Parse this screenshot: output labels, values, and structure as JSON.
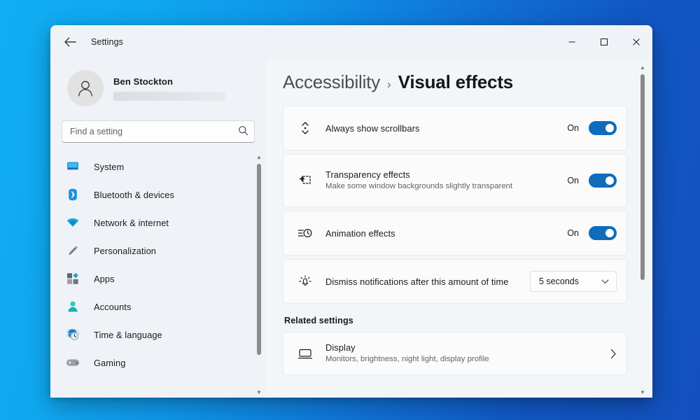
{
  "window": {
    "titlebar_title": "Settings",
    "back_icon": "arrow-left-icon",
    "controls": {
      "minimize": "minimize-icon",
      "maximize": "maximize-icon",
      "close": "close-icon"
    }
  },
  "account": {
    "name": "Ben Stockton",
    "email_redacted": true,
    "avatar_icon": "person-icon"
  },
  "search": {
    "placeholder": "Find a setting",
    "value": "",
    "icon": "search-icon"
  },
  "sidebar": {
    "items": [
      {
        "label": "System",
        "icon": "system-monitor-icon"
      },
      {
        "label": "Bluetooth & devices",
        "icon": "bluetooth-icon"
      },
      {
        "label": "Network & internet",
        "icon": "wifi-icon"
      },
      {
        "label": "Personalization",
        "icon": "paintbrush-icon"
      },
      {
        "label": "Apps",
        "icon": "apps-grid-icon"
      },
      {
        "label": "Accounts",
        "icon": "accounts-person-icon"
      },
      {
        "label": "Time & language",
        "icon": "clock-globe-icon"
      },
      {
        "label": "Gaming",
        "icon": "gamepad-icon"
      }
    ],
    "scrollbar": {
      "up_arrow": "chevron-up-icon",
      "down_arrow": "chevron-down-icon"
    }
  },
  "breadcrumb": {
    "parent": "Accessibility",
    "separator": "›",
    "current": "Visual effects"
  },
  "settings": [
    {
      "title": "Always show scrollbars",
      "subtitle": "",
      "icon": "scrollbar-icon",
      "control": "toggle",
      "state_label": "On",
      "state_on": true
    },
    {
      "title": "Transparency effects",
      "subtitle": "Make some window backgrounds slightly transparent",
      "icon": "transparency-sparkle-icon",
      "control": "toggle",
      "state_label": "On",
      "state_on": true
    },
    {
      "title": "Animation effects",
      "subtitle": "",
      "icon": "animation-lines-clock-icon",
      "control": "toggle",
      "state_label": "On",
      "state_on": true
    },
    {
      "title": "Dismiss notifications after this amount of time",
      "subtitle": "",
      "icon": "notification-bell-icon",
      "control": "dropdown",
      "selected": "5 seconds",
      "chevron": "chevron-down-icon"
    }
  ],
  "related": {
    "heading": "Related settings",
    "items": [
      {
        "title": "Display",
        "subtitle": "Monitors, brightness, night light, display profile",
        "icon": "display-monitor-icon",
        "chevron": "chevron-right-icon"
      }
    ]
  },
  "colors": {
    "accent_blue": "#0f6cbd",
    "window_chrome": "#eff3f7",
    "page_background": "#f3f6f9",
    "card_background": "#fbfbfb",
    "desktop_gradient_start": "#11aef3",
    "desktop_gradient_end": "#1250bd"
  }
}
